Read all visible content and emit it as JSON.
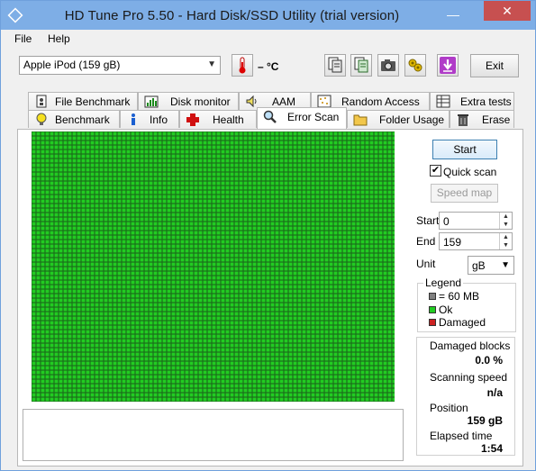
{
  "window": {
    "title": "HD Tune Pro 5.50 - Hard Disk/SSD Utility (trial version)",
    "minimize_glyph": "—",
    "close_glyph": "✕"
  },
  "menu": {
    "file": "File",
    "help": "Help"
  },
  "toolbar": {
    "drive": "Apple   iPod (159 gB)",
    "temperature": "– °C",
    "exit_label": "Exit",
    "icons": [
      "thermometer-icon",
      "copy-info-icon",
      "copy-text-icon",
      "camera-icon",
      "options-icon",
      "save-icon"
    ]
  },
  "tabs_row1": [
    {
      "label": "File Benchmark",
      "icon": "file-benchmark-icon"
    },
    {
      "label": "Disk monitor",
      "icon": "disk-monitor-icon"
    },
    {
      "label": "AAM",
      "icon": "speaker-icon"
    },
    {
      "label": "Random Access",
      "icon": "random-access-icon"
    },
    {
      "label": "Extra tests",
      "icon": "extra-tests-icon"
    }
  ],
  "tabs_row2": [
    {
      "label": "Benchmark",
      "icon": "lightbulb-icon"
    },
    {
      "label": "Info",
      "icon": "info-icon"
    },
    {
      "label": "Health",
      "icon": "health-cross-icon"
    },
    {
      "label": "Error Scan",
      "icon": "magnifier-icon",
      "active": true
    },
    {
      "label": "Folder Usage",
      "icon": "folder-icon"
    },
    {
      "label": "Erase",
      "icon": "trash-icon"
    }
  ],
  "scan": {
    "start_label": "Start",
    "quick_scan_label": "Quick scan",
    "quick_scan_checked": true,
    "speed_map_label": "Speed map",
    "start_field_label": "Start",
    "start_value": "0",
    "end_field_label": "End",
    "end_value": "159",
    "unit_label": "Unit",
    "unit_value": "gB"
  },
  "legend": {
    "title": "Legend",
    "items": [
      {
        "label": "= 60 MB",
        "color": "#808080"
      },
      {
        "label": "Ok",
        "color": "#22cc22"
      },
      {
        "label": "Damaged",
        "color": "#cc2222"
      }
    ]
  },
  "stats": {
    "damaged_blocks_label": "Damaged blocks",
    "damaged_blocks_value": "0.0 %",
    "scanning_speed_label": "Scanning speed",
    "scanning_speed_value": "n/a",
    "position_label": "Position",
    "position_value": "159 gB",
    "elapsed_label": "Elapsed time",
    "elapsed_value": "1:54"
  },
  "colors": {
    "block_ok": "#22cc22",
    "block_border": "#1a6e1a"
  },
  "block_map": {
    "status": "all ok"
  }
}
